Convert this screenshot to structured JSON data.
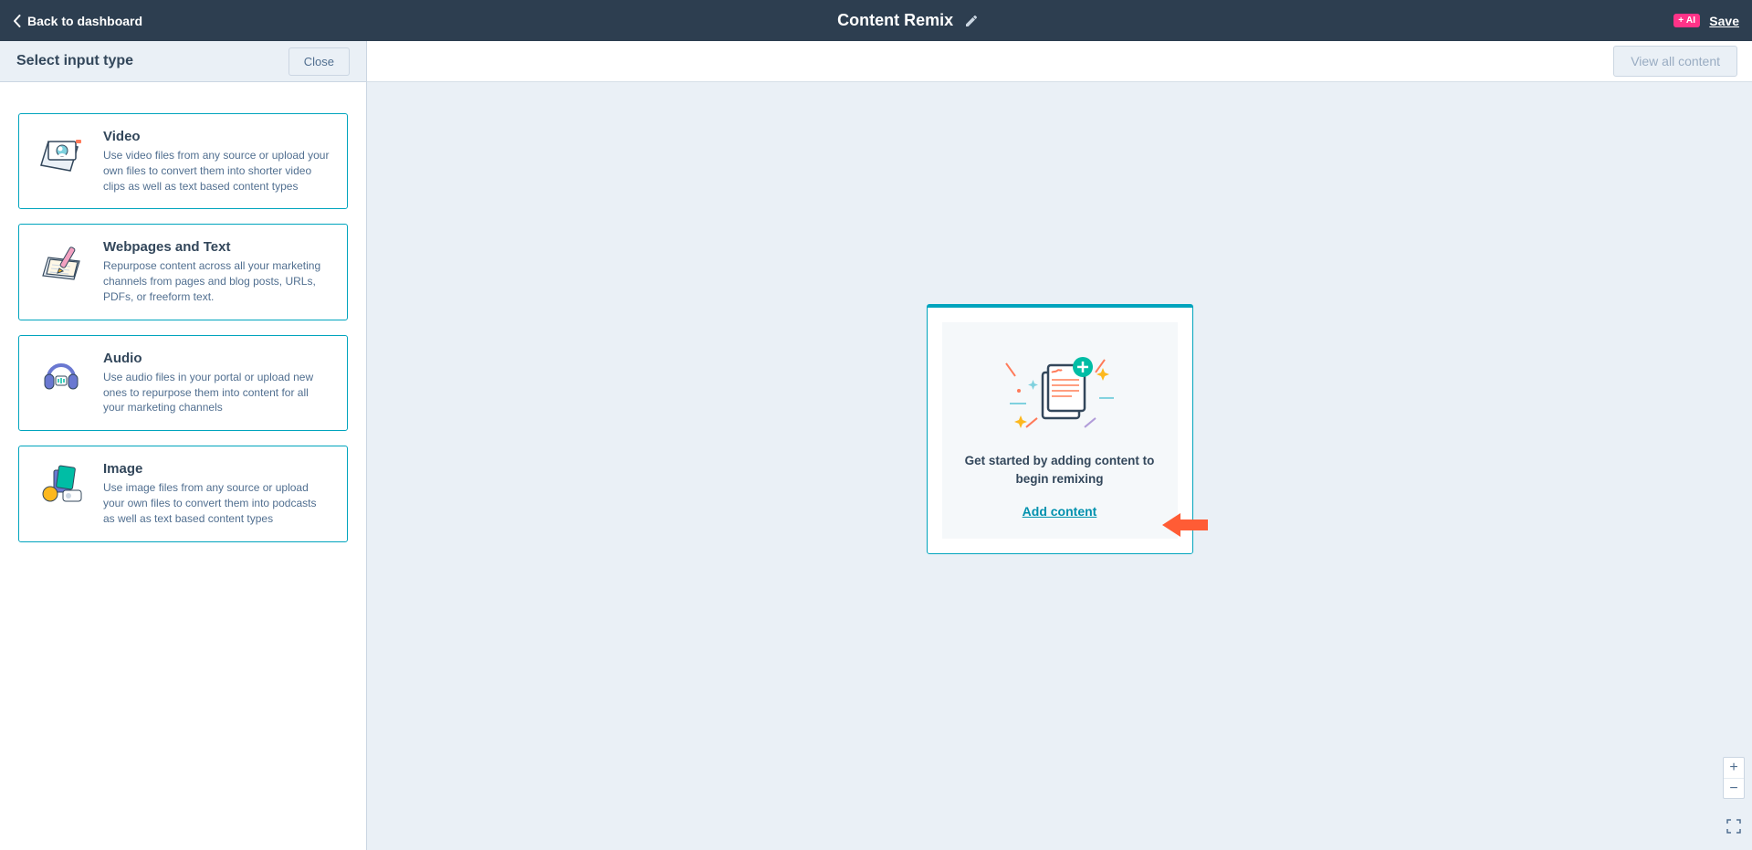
{
  "header": {
    "back_label": "Back to dashboard",
    "title": "Content Remix",
    "ai_badge": "+ AI",
    "save_label": "Save"
  },
  "sidebar": {
    "title": "Select input type",
    "close_label": "Close",
    "options": [
      {
        "title": "Video",
        "desc": "Use video files from any source or upload your own files to convert them into shorter video clips as well as text based content types"
      },
      {
        "title": "Webpages and Text",
        "desc": "Repurpose content across all your marketing channels from pages and blog posts, URLs, PDFs, or freeform text."
      },
      {
        "title": "Audio",
        "desc": "Use audio files in your portal or upload new ones to repurpose them into content for all your marketing channels"
      },
      {
        "title": "Image",
        "desc": "Use image files from any source or upload your own files to convert them into podcasts as well as text based content types"
      }
    ]
  },
  "canvas": {
    "view_all_label": "View all content",
    "empty_msg": "Get started by adding content to begin remixing",
    "add_content_label": "Add content"
  }
}
